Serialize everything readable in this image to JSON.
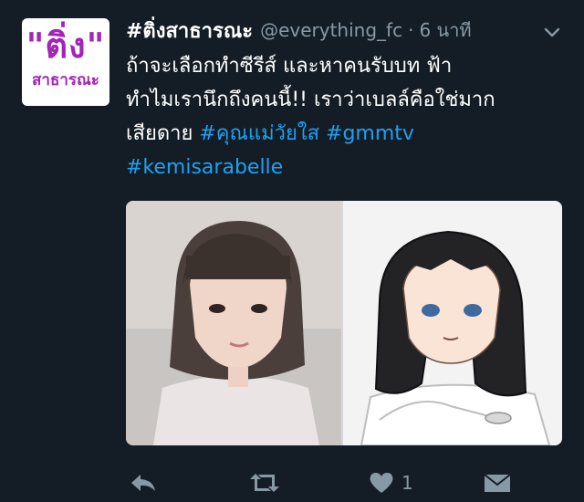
{
  "account": {
    "avatar_big": "\"ติ่ง\"",
    "avatar_small": "สาธารณะ",
    "display_name": "#ติ่งสาธารณะ",
    "handle": "@everything_fc",
    "separator": "·",
    "time": "6 นาที"
  },
  "tweet": {
    "line1": "ถ้าจะเลือกทำซีรีส์ และหาคนรับบท ฟ้า",
    "line2": "ทำไมเรานึกถึงคนนี้!! เราว่าเบลล์คือใช่มาก",
    "line3_text": "เสียดาย",
    "hashtag1": "#คุณแม่วัยใส",
    "hashtag2": "#gmmtv",
    "hashtag3": "#kemisarabelle"
  },
  "actions": {
    "like_count": "1"
  },
  "colors": {
    "background": "#141d26",
    "text": "#ffffff",
    "muted": "#8899a6",
    "link": "#1da1f2",
    "avatar_accent": "#a224b8"
  },
  "icons": [
    "chevron-down-icon",
    "reply-icon",
    "retweet-icon",
    "heart-icon",
    "direct-message-icon"
  ]
}
